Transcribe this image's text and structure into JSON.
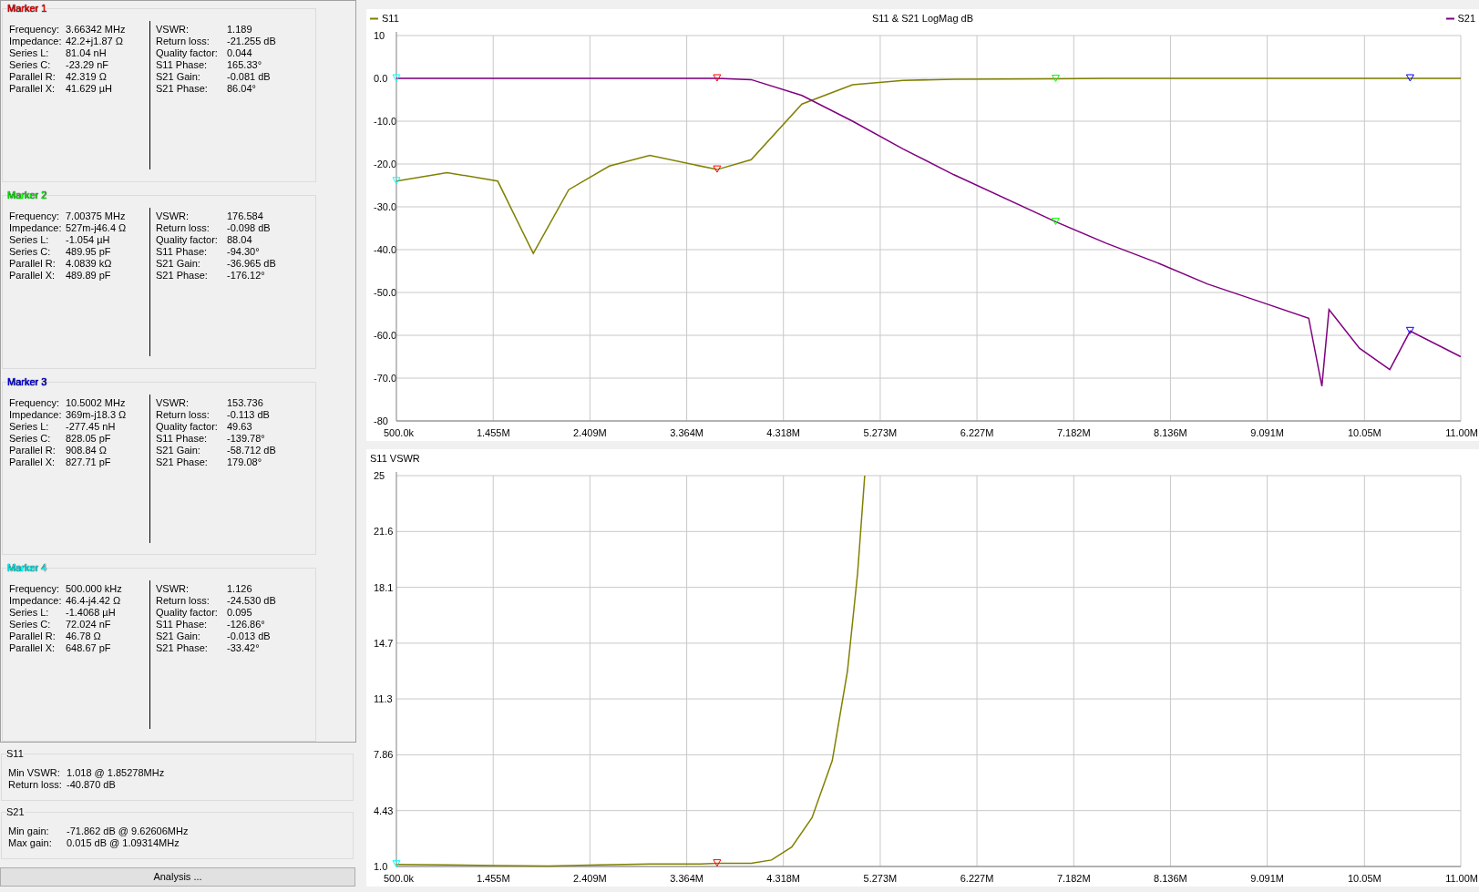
{
  "markers": [
    {
      "title": "Marker 1",
      "color": "#ff0000",
      "left": [
        {
          "label": "Frequency:",
          "value": "3.66342 MHz"
        },
        {
          "label": "Impedance:",
          "value": "42.2+j1.87 Ω"
        },
        {
          "label": "Series L:",
          "value": "81.04 nH"
        },
        {
          "label": "Series C:",
          "value": "-23.29 nF"
        },
        {
          "label": "Parallel R:",
          "value": "42.319 Ω"
        },
        {
          "label": "Parallel X:",
          "value": "41.629 µH"
        }
      ],
      "right": [
        {
          "label": "VSWR:",
          "value": "1.189"
        },
        {
          "label": "Return loss:",
          "value": "-21.255 dB"
        },
        {
          "label": "Quality factor:",
          "value": "0.044"
        },
        {
          "label": "S11 Phase:",
          "value": "165.33°"
        },
        {
          "label": "S21 Gain:",
          "value": "-0.081 dB"
        },
        {
          "label": "S21 Phase:",
          "value": "86.04°"
        }
      ]
    },
    {
      "title": "Marker 2",
      "color": "#00ff00",
      "left": [
        {
          "label": "Frequency:",
          "value": "7.00375 MHz"
        },
        {
          "label": "Impedance:",
          "value": "527m-j46.4 Ω"
        },
        {
          "label": "Series L:",
          "value": "-1.054 µH"
        },
        {
          "label": "Series C:",
          "value": "489.95 pF"
        },
        {
          "label": "Parallel R:",
          "value": "4.0839 kΩ"
        },
        {
          "label": "Parallel X:",
          "value": "489.89 pF"
        }
      ],
      "right": [
        {
          "label": "VSWR:",
          "value": "176.584"
        },
        {
          "label": "Return loss:",
          "value": "-0.098 dB"
        },
        {
          "label": "Quality factor:",
          "value": "88.04"
        },
        {
          "label": "S11 Phase:",
          "value": "-94.30°"
        },
        {
          "label": "S21 Gain:",
          "value": "-36.965 dB"
        },
        {
          "label": "S21 Phase:",
          "value": "-176.12°"
        }
      ]
    },
    {
      "title": "Marker 3",
      "color": "#0000ff",
      "left": [
        {
          "label": "Frequency:",
          "value": "10.5002 MHz"
        },
        {
          "label": "Impedance:",
          "value": "369m-j18.3 Ω"
        },
        {
          "label": "Series L:",
          "value": "-277.45 nH"
        },
        {
          "label": "Series C:",
          "value": "828.05 pF"
        },
        {
          "label": "Parallel R:",
          "value": "908.84 Ω"
        },
        {
          "label": "Parallel X:",
          "value": "827.71 pF"
        }
      ],
      "right": [
        {
          "label": "VSWR:",
          "value": "153.736"
        },
        {
          "label": "Return loss:",
          "value": "-0.113 dB"
        },
        {
          "label": "Quality factor:",
          "value": "49.63"
        },
        {
          "label": "S11 Phase:",
          "value": "-139.78°"
        },
        {
          "label": "S21 Gain:",
          "value": "-58.712 dB"
        },
        {
          "label": "S21 Phase:",
          "value": "179.08°"
        }
      ]
    },
    {
      "title": "Marker 4",
      "color": "#00ffff",
      "left": [
        {
          "label": "Frequency:",
          "value": "500.000 kHz"
        },
        {
          "label": "Impedance:",
          "value": "46.4-j4.42 Ω"
        },
        {
          "label": "Series L:",
          "value": "-1.4068 µH"
        },
        {
          "label": "Series C:",
          "value": "72.024 nF"
        },
        {
          "label": "Parallel R:",
          "value": "46.78 Ω"
        },
        {
          "label": "Parallel X:",
          "value": "648.67 pF"
        }
      ],
      "right": [
        {
          "label": "VSWR:",
          "value": "1.126"
        },
        {
          "label": "Return loss:",
          "value": "-24.530 dB"
        },
        {
          "label": "Quality factor:",
          "value": "0.095"
        },
        {
          "label": "S11 Phase:",
          "value": "-126.86°"
        },
        {
          "label": "S21 Gain:",
          "value": "-0.013 dB"
        },
        {
          "label": "S21 Phase:",
          "value": "-33.42°"
        }
      ]
    }
  ],
  "summaries": [
    {
      "title": "S11",
      "rows": [
        {
          "label": "Min VSWR:",
          "value": "1.018 @ 1.85278MHz"
        },
        {
          "label": "Return loss:",
          "value": "-40.870 dB"
        }
      ]
    },
    {
      "title": "S21",
      "rows": [
        {
          "label": "Min gain:",
          "value": "-71.862 dB @ 9.62606MHz"
        },
        {
          "label": "Max gain:",
          "value": "0.015 dB @ 1.09314MHz"
        }
      ]
    }
  ],
  "analysis_button": "Analysis ...",
  "charts": [
    {
      "chart_data": {
        "type": "line",
        "title": "S11 & S21 LogMag dB",
        "grid": true,
        "legend": "top",
        "x": [
          500000,
          1000000,
          1500000,
          1850000,
          2200000,
          2600000,
          3000000,
          3663420,
          4000000,
          4500000,
          5000000,
          5500000,
          6000000,
          7003750,
          7500000,
          8000000,
          8500000,
          9000000,
          9500000,
          9630000,
          9700000,
          10000000,
          10300000,
          10500200,
          11000000
        ],
        "series": [
          {
            "name": "S11",
            "color": "#808000",
            "values": [
              -24,
              -22,
              -24,
              -40.9,
              -26,
              -20.5,
              -18,
              -21.3,
              -19,
              -6,
              -1.5,
              -0.5,
              -0.2,
              -0.1,
              0,
              0,
              0,
              0,
              0,
              0,
              0,
              0,
              0,
              0,
              0
            ]
          },
          {
            "name": "S21",
            "color": "#800080",
            "values": [
              0,
              0,
              0,
              0,
              0,
              0,
              0,
              0,
              -0.3,
              -4,
              -10,
              -16.5,
              -22.5,
              -33.5,
              -38.5,
              -43,
              -48,
              -52,
              -56,
              -71.9,
              -54,
              -63,
              -68,
              -59,
              -65
            ]
          }
        ],
        "xlim": [
          500000,
          11000000
        ],
        "ylim": [
          -80,
          10
        ],
        "xticks": [
          {
            "value": 500000,
            "label": "500.0k"
          },
          {
            "value": 1455000,
            "label": "1.455M"
          },
          {
            "value": 2409000,
            "label": "2.409M"
          },
          {
            "value": 3364000,
            "label": "3.364M"
          },
          {
            "value": 4318000,
            "label": "4.318M"
          },
          {
            "value": 5273000,
            "label": "5.273M"
          },
          {
            "value": 6227000,
            "label": "6.227M"
          },
          {
            "value": 7182000,
            "label": "7.182M"
          },
          {
            "value": 8136000,
            "label": "8.136M"
          },
          {
            "value": 9091000,
            "label": "9.091M"
          },
          {
            "value": 10050000,
            "label": "10.05M"
          },
          {
            "value": 11000000,
            "label": "11.00M"
          }
        ],
        "yticks": [
          {
            "value": 10,
            "label": "10"
          },
          {
            "value": 0,
            "label": "0.0"
          },
          {
            "value": -10,
            "label": "-10.0"
          },
          {
            "value": -20,
            "label": "-20.0"
          },
          {
            "value": -30,
            "label": "-30.0"
          },
          {
            "value": -40,
            "label": "-40.0"
          },
          {
            "value": -50,
            "label": "-50.0"
          },
          {
            "value": -60,
            "label": "-60.0"
          },
          {
            "value": -70,
            "label": "-70.0"
          },
          {
            "value": -80,
            "label": "-80"
          }
        ]
      }
    },
    {
      "chart_data": {
        "type": "line",
        "title": "S11 VSWR",
        "grid": true,
        "x": [
          500000,
          1000000,
          1500000,
          2000000,
          2500000,
          3000000,
          3500000,
          3663420,
          4000000,
          4200000,
          4400000,
          4600000,
          4800000,
          4950000,
          5050000,
          5120000
        ],
        "series": [
          {
            "color": "#808000",
            "values": [
              1.13,
              1.1,
              1.05,
              1.03,
              1.1,
              1.15,
              1.15,
              1.19,
              1.2,
              1.4,
              2.2,
              4,
              7.5,
              13,
              19,
              25
            ]
          }
        ],
        "xlim": [
          500000,
          11000000
        ],
        "ylim": [
          1,
          25
        ],
        "xticks": [
          {
            "value": 500000,
            "label": "500.0k"
          },
          {
            "value": 1455000,
            "label": "1.455M"
          },
          {
            "value": 2409000,
            "label": "2.409M"
          },
          {
            "value": 3364000,
            "label": "3.364M"
          },
          {
            "value": 4318000,
            "label": "4.318M"
          },
          {
            "value": 5273000,
            "label": "5.273M"
          },
          {
            "value": 6227000,
            "label": "6.227M"
          },
          {
            "value": 7182000,
            "label": "7.182M"
          },
          {
            "value": 8136000,
            "label": "8.136M"
          },
          {
            "value": 9091000,
            "label": "9.091M"
          },
          {
            "value": 10050000,
            "label": "10.05M"
          },
          {
            "value": 11000000,
            "label": "11.00M"
          }
        ],
        "yticks": [
          {
            "value": 25,
            "label": "25"
          },
          {
            "value": 21.57,
            "label": "21.6"
          },
          {
            "value": 18.14,
            "label": "18.1"
          },
          {
            "value": 14.71,
            "label": "14.7"
          },
          {
            "value": 11.29,
            "label": "11.3"
          },
          {
            "value": 7.86,
            "label": "7.86"
          },
          {
            "value": 4.43,
            "label": "4.43"
          },
          {
            "value": 1,
            "label": "1.0"
          }
        ]
      }
    }
  ]
}
